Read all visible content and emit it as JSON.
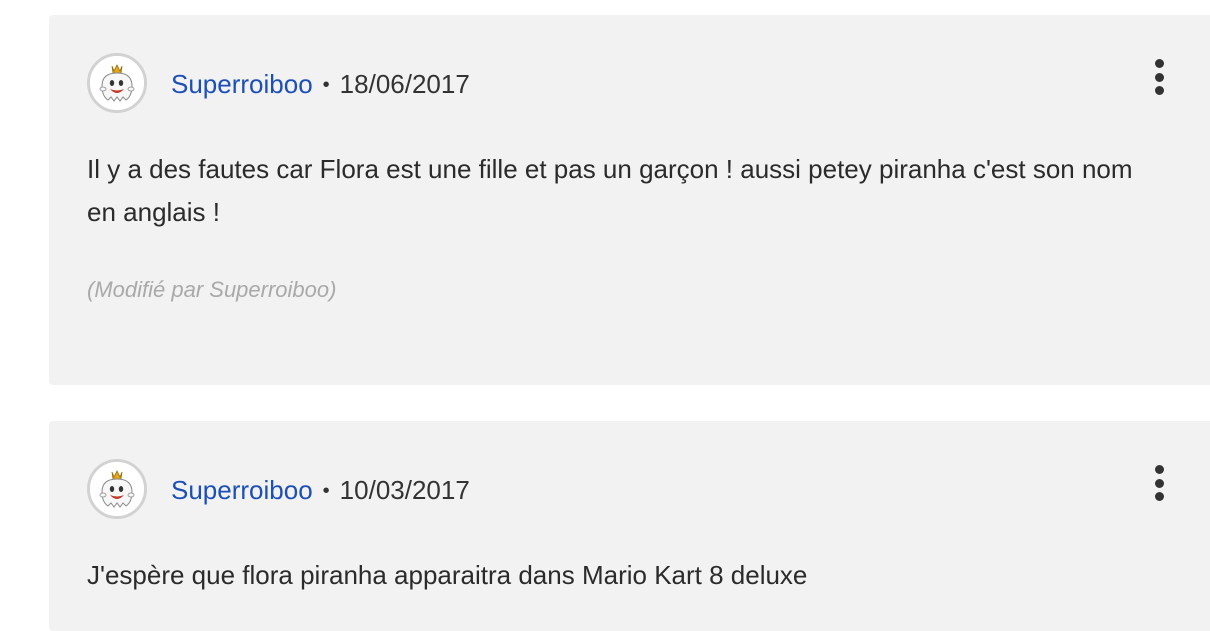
{
  "comments": [
    {
      "avatar_icon": "king-boo-avatar-icon",
      "username": "Superroiboo",
      "separator": "•",
      "date": "18/06/2017",
      "menu_icon": "more-vertical-icon",
      "text": "Il y a des fautes car Flora est une fille et pas un garçon ! aussi petey piranha c'est son nom en anglais !",
      "edited_note": "(Modifié par Superroiboo)"
    },
    {
      "avatar_icon": "king-boo-avatar-icon",
      "username": "Superroiboo",
      "separator": "•",
      "date": "10/03/2017",
      "menu_icon": "more-vertical-icon",
      "text": "J'espère que flora piranha apparaitra dans Mario Kart 8 deluxe"
    }
  ],
  "colors": {
    "username": "#1c4fb8",
    "card_background": "#f2f2f2",
    "text": "#2b2b2b",
    "muted": "#a9a9a9"
  }
}
